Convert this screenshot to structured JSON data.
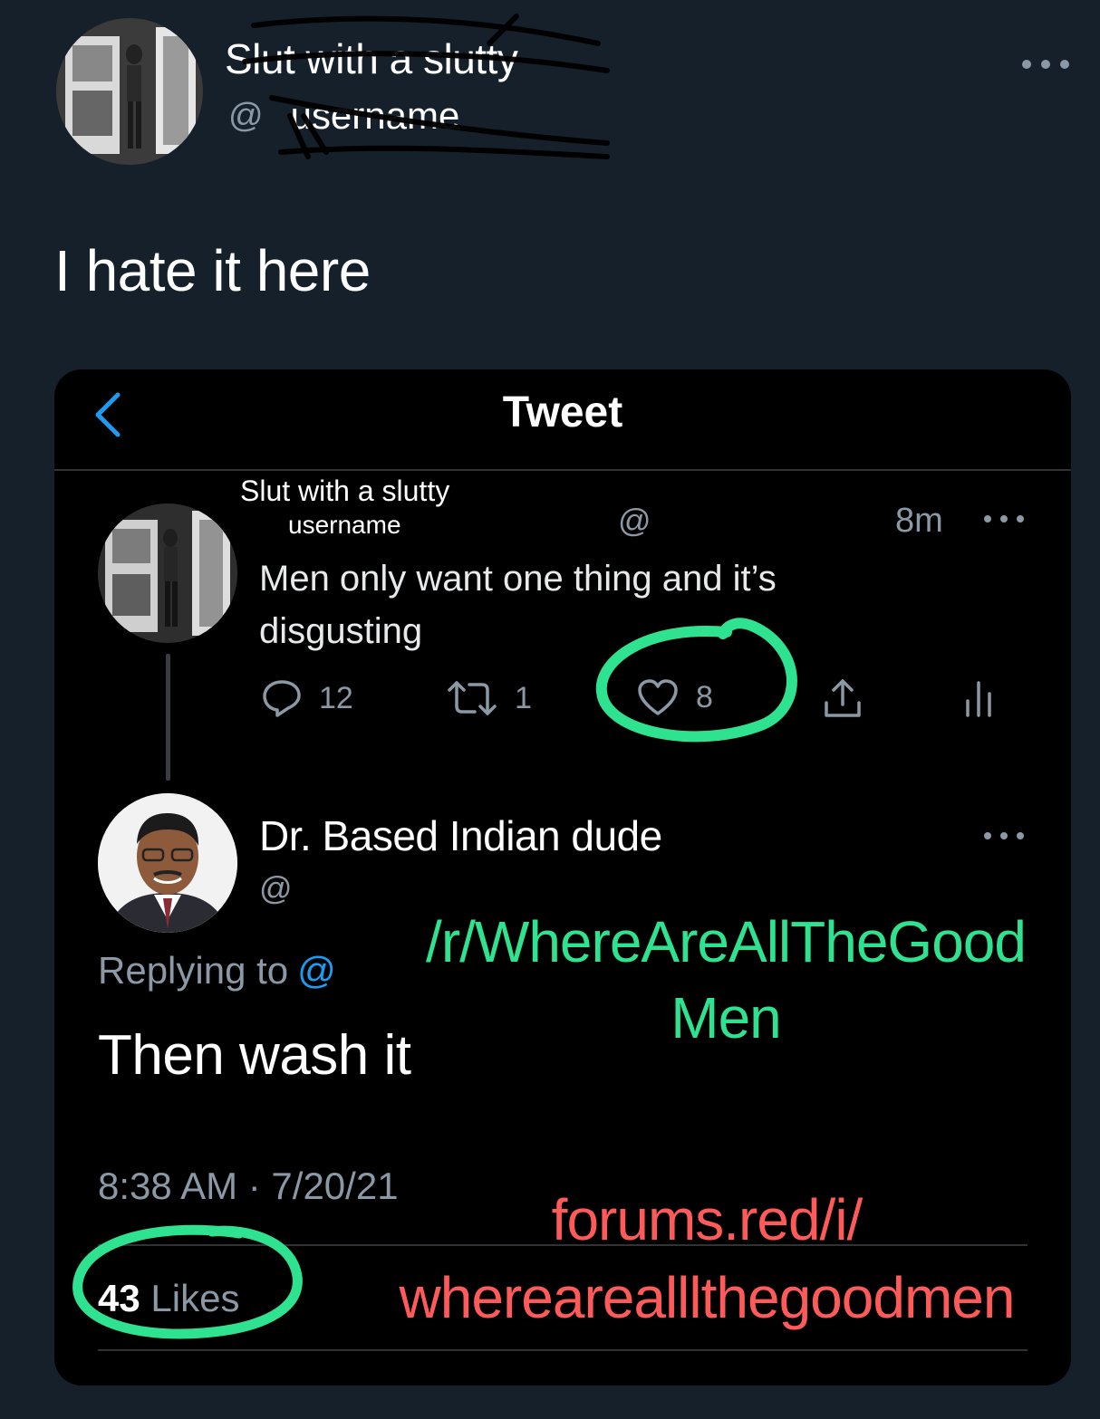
{
  "outer": {
    "name": "Slut with a slutty",
    "handle_prefix": "@",
    "handle": "username",
    "text": "I hate it here"
  },
  "embed": {
    "header_title": "Tweet",
    "tweet1": {
      "name_line1": "Slut with a slutty",
      "name_line2": "username",
      "handle_prefix": "@",
      "time": "8m",
      "text": "Men only want one thing and it’s disgusting",
      "reply_count": "12",
      "retweet_count": "1",
      "like_count": "8"
    },
    "tweet2": {
      "name": "Dr. Based Indian dude",
      "handle_prefix": "@",
      "replying_label": "Replying to",
      "replying_handle": "@",
      "text": "Then wash it",
      "timestamp": "8:38 AM · 7/20/21",
      "likes_count": "43",
      "likes_label": "Likes"
    }
  },
  "watermarks": {
    "subreddit_line1": "/r/WhereAreAllTheGood",
    "subreddit_line2": "Men",
    "forum_line1": "forums.red/i/",
    "forum_line2": "wherearealllthegoodmen"
  },
  "colors": {
    "background": "#15202b",
    "embed_background": "#000000",
    "muted_text": "#8b98a5",
    "link_blue": "#1d9bf0",
    "highlight_green": "#2fe28f",
    "watermark_red": "#ff5a5a"
  },
  "icons": [
    "more-icon",
    "back-chevron-icon",
    "reply-icon",
    "retweet-icon",
    "like-icon",
    "share-icon",
    "stats-icon"
  ]
}
